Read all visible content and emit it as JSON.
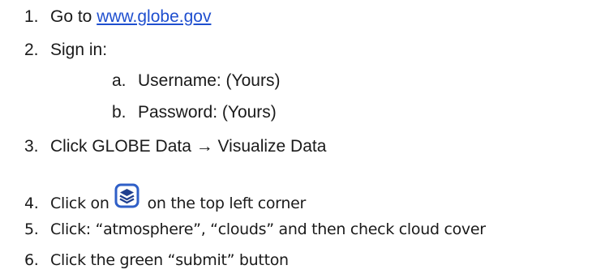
{
  "steps": [
    {
      "num": "1.",
      "text": "Go to ",
      "link": "www.globe.gov"
    },
    {
      "num": "2.",
      "text": "Sign in:"
    },
    {
      "num": "a.",
      "text": "Username: (Yours)"
    },
    {
      "num": "b.",
      "text": "Password: (Yours)"
    },
    {
      "num": "3.",
      "text": "Click GLOBE Data → Visualize Data"
    },
    {
      "num": "4.",
      "text_before": "Click on",
      "icon": "layers-icon",
      "text_after": "on the top left corner"
    },
    {
      "num": "5.",
      "text": "Click: “atmosphere”, “clouds” and then check cloud cover"
    },
    {
      "num": "6.",
      "text": "Click the green “submit” button"
    }
  ],
  "colors": {
    "link": "#1f4fcf",
    "icon_stroke": "#2f5fc7"
  }
}
